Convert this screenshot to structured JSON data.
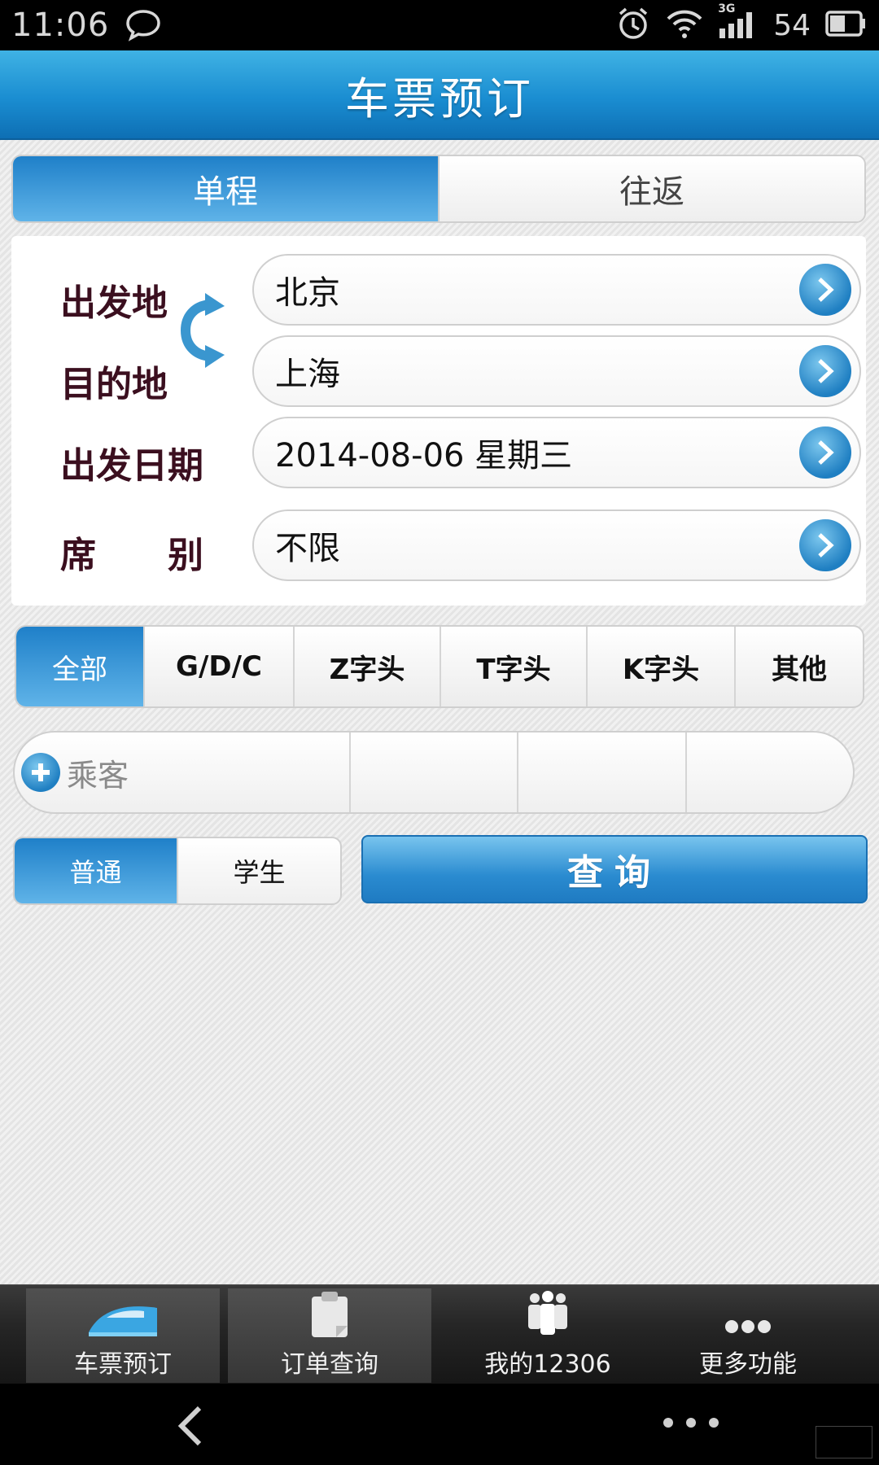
{
  "status_bar": {
    "time": "11:06",
    "network": "3G",
    "battery": "54"
  },
  "header": {
    "title": "车票预订"
  },
  "trip_type": {
    "tabs": [
      {
        "label": "单程",
        "active": true
      },
      {
        "label": "往返",
        "active": false
      }
    ]
  },
  "form": {
    "from_label": "出发地",
    "from_value": "北京",
    "to_label": "目的地",
    "to_value": "上海",
    "date_label": "出发日期",
    "date_value": "2014-08-06 星期三",
    "seat_label": "席　　别",
    "seat_value": "不限"
  },
  "train_types": {
    "tabs": [
      {
        "label": "全部",
        "active": true
      },
      {
        "label": "G/D/C",
        "active": false
      },
      {
        "label": "Z字头",
        "active": false
      },
      {
        "label": "T字头",
        "active": false
      },
      {
        "label": "K字头",
        "active": false
      },
      {
        "label": "其他",
        "active": false
      }
    ]
  },
  "passenger": {
    "add_label": "乘客"
  },
  "ticket_type": {
    "tabs": [
      {
        "label": "普通",
        "active": true
      },
      {
        "label": "学生",
        "active": false
      }
    ]
  },
  "query_button": {
    "label": "查询"
  },
  "tabbar": {
    "items": [
      {
        "label": "车票预订",
        "icon": "train-icon",
        "selected": true
      },
      {
        "label": "订单查询",
        "icon": "clipboard-icon",
        "selected": false
      },
      {
        "label": "我的12306",
        "icon": "people-icon",
        "selected": false
      },
      {
        "label": "更多功能",
        "icon": "more-dots-icon",
        "selected": false
      }
    ]
  },
  "colors": {
    "accent": "#1f80c9",
    "header_top": "#3fb2e4",
    "label_text": "#3b0f1f"
  }
}
